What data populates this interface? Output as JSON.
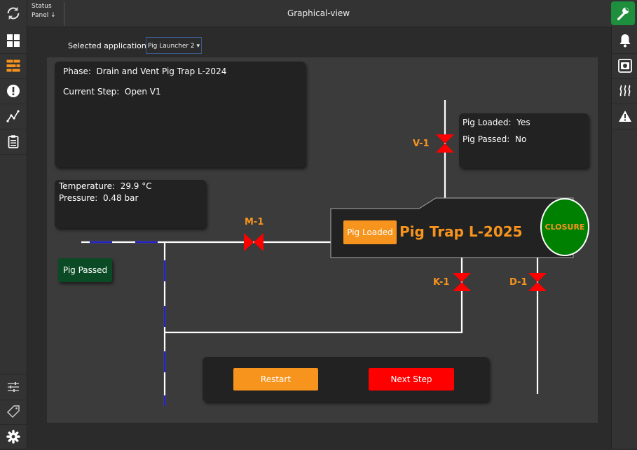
{
  "header": {
    "title": "Graphical-view",
    "status_panel_line1": "Status",
    "status_panel_line2": "Panel ↓"
  },
  "icons": {
    "refresh": "refresh-icon",
    "wrench": "wrench-icon",
    "left_sidebar": [
      "dashboard-icon",
      "graphical-view-icon",
      "alert-icon",
      "trend-icon",
      "clipboard-icon",
      "sliders-icon",
      "tag-icon",
      "gear-icon"
    ],
    "right_sidebar": [
      "bell-icon",
      "camera-icon",
      "heat-icon",
      "warning-icon"
    ]
  },
  "selector": {
    "label": "Selected application",
    "value": "Pig Launcher 2 ▾"
  },
  "phase_card": {
    "phase_label": "Phase:",
    "phase_value": "Drain and Vent Pig Trap L-2024",
    "step_label": "Current Step:",
    "step_value": "Open V1"
  },
  "process_values": {
    "temperature_label": "Temperature:",
    "temperature_value": "29.9 °C",
    "pressure_label": "Pressure:",
    "pressure_value": "0.48 bar"
  },
  "pig_status": {
    "loaded_label": "Pig Loaded:",
    "loaded_value": "Yes",
    "passed_label": "Pig Passed:",
    "passed_value": "No"
  },
  "diagram": {
    "trap_name": "Pig Trap L-2025",
    "pig_loaded_button": "Pig Loaded",
    "closure_label": "CLOSURE",
    "pig_passed_indicator": "Pig Passed",
    "valves": [
      "V-1",
      "M-1",
      "K-1",
      "D-1"
    ]
  },
  "controls": {
    "restart": "Restart",
    "next_step": "Next Step"
  },
  "colors": {
    "accent": "#f7941d",
    "valve": "#ff0000",
    "closure": "#008000",
    "active_tool": "#1e8f3c",
    "pig_passed": "#0a4a25"
  }
}
